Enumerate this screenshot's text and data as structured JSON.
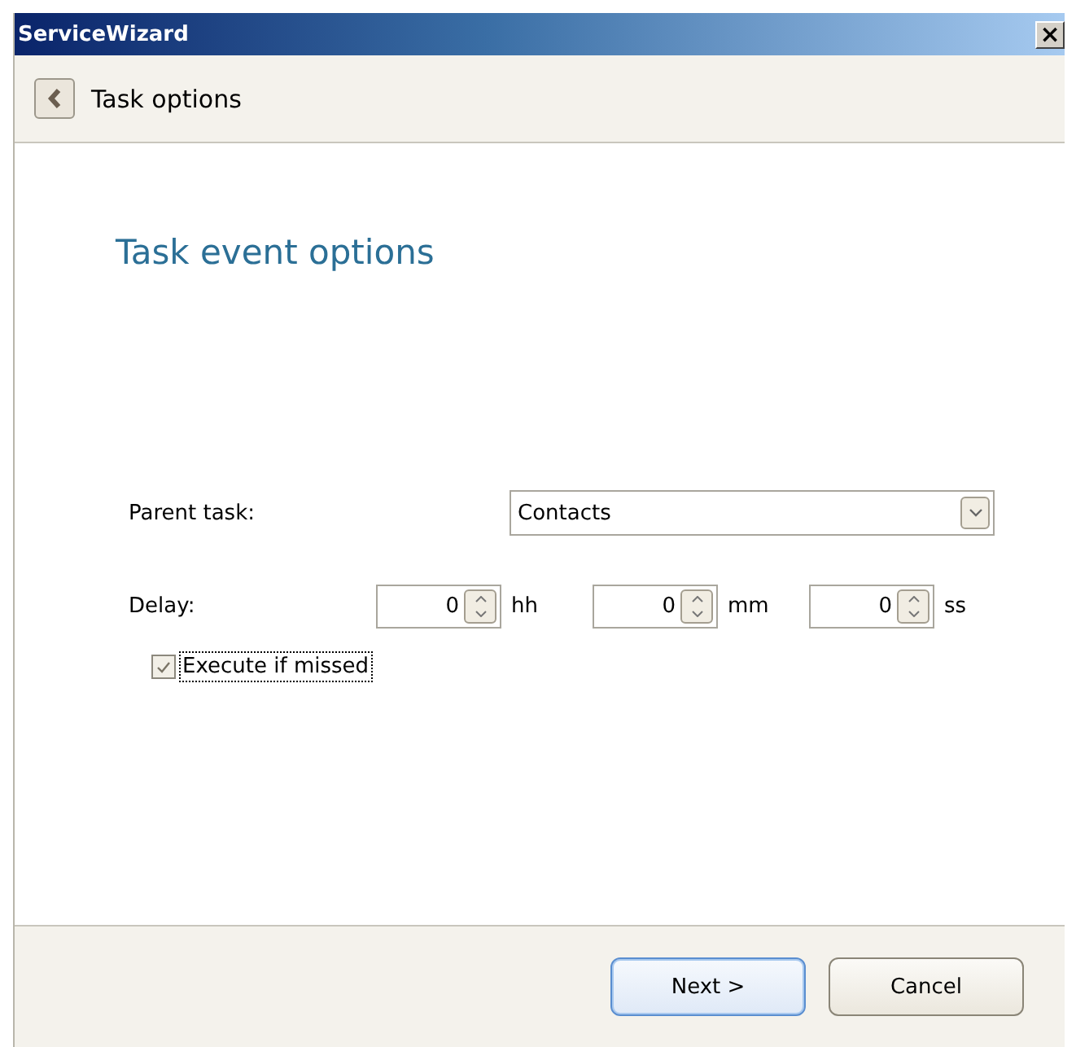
{
  "window": {
    "title": "ServiceWizard",
    "close": "×"
  },
  "header": {
    "title": "Task options"
  },
  "section_title": "Task event options",
  "parent_task": {
    "label": "Parent task:",
    "value": "Contacts"
  },
  "delay": {
    "label": "Delay:",
    "fields": [
      {
        "value": "0",
        "unit": "hh"
      },
      {
        "value": "0",
        "unit": "mm"
      },
      {
        "value": "0",
        "unit": "ss"
      }
    ]
  },
  "execute_if_missed": {
    "label": "Execute if missed",
    "checked": true
  },
  "buttons": [
    {
      "label": "Next >",
      "kind": "default"
    },
    {
      "label": "Cancel",
      "kind": "normal"
    }
  ]
}
